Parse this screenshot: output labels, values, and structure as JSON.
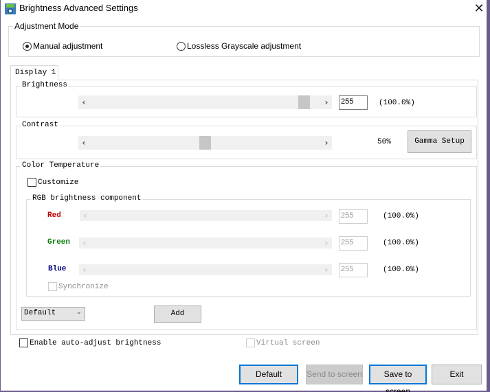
{
  "window": {
    "title": "Brightness Advanced Settings",
    "close_glyph": "✕"
  },
  "adjustment_mode": {
    "legend": "Adjustment Mode",
    "options": [
      {
        "label": "Manual adjustment",
        "selected": true
      },
      {
        "label": "Lossless Grayscale adjustment",
        "selected": false
      }
    ]
  },
  "tabs": [
    {
      "label": "Display 1",
      "active": true
    }
  ],
  "brightness": {
    "legend": "Brightness",
    "value": "255",
    "percent_text": "(100.0%)",
    "slider_fraction": 0.95,
    "left_arrow": "‹",
    "right_arrow": "›"
  },
  "contrast": {
    "legend": "Contrast",
    "value_text": "50%",
    "slider_fraction": 0.5,
    "gamma_button": "Gamma Setup"
  },
  "color_temperature": {
    "legend": "Color Temperature",
    "customize_label": "Customize",
    "customize_checked": false,
    "rgb_group": {
      "legend": "RGB brightness component",
      "channels": [
        {
          "label": "Red",
          "color": "#c00000",
          "value": "255",
          "percent_text": "(100.0%)"
        },
        {
          "label": "Green",
          "color": "#0a7a0a",
          "value": "255",
          "percent_text": "(100.0%)"
        },
        {
          "label": "Blue",
          "color": "#000080",
          "value": "255",
          "percent_text": "(100.0%)"
        }
      ],
      "synchronize_label": "Synchronize"
    },
    "preset_select": "Default",
    "add_button": "Add"
  },
  "auto_adjust": {
    "label": "Enable auto-adjust brightness",
    "checked": false
  },
  "virtual_screen": {
    "label": "Virtual screen",
    "checked": false,
    "enabled": false
  },
  "footer": {
    "default_button": "Default",
    "send_button": "Send to screen",
    "save_button": "Save to screen",
    "exit_button": "Exit"
  }
}
